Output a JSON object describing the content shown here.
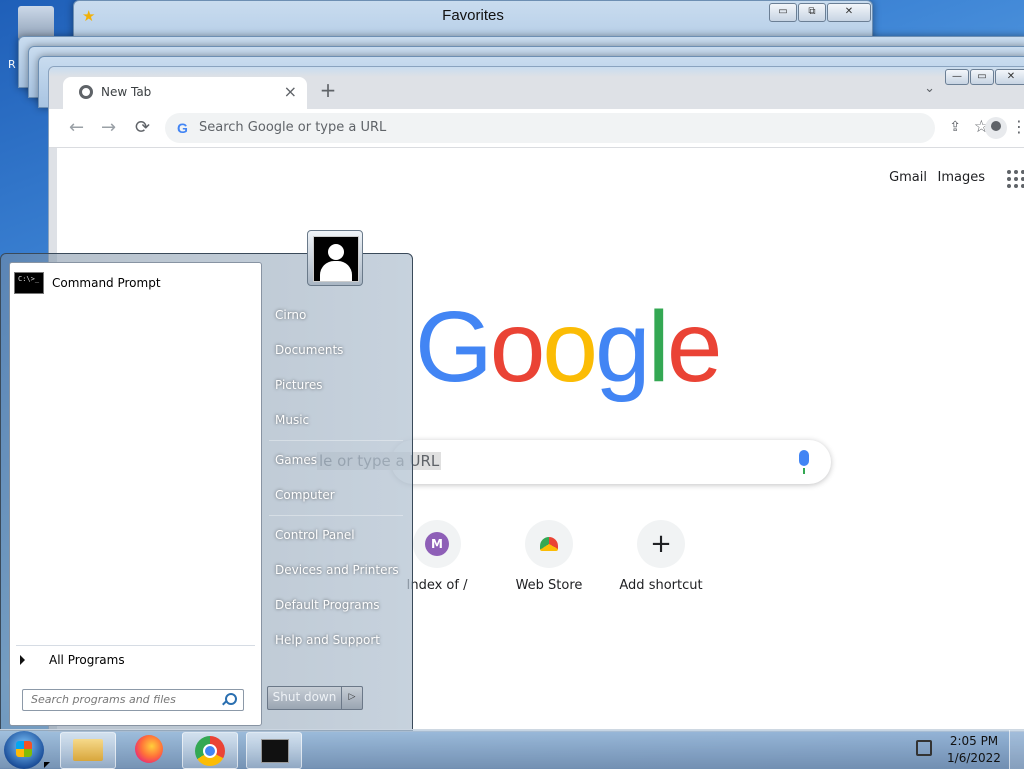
{
  "desktop": {
    "side_letter": "R"
  },
  "favorites_window": {
    "title": "Favorites",
    "minimize": "▭",
    "restore": "⧉",
    "close": "✕"
  },
  "chrome": {
    "tab_title": "New Tab",
    "tab_close": "×",
    "new_tab": "+",
    "tab_search": "⌄",
    "back": "←",
    "forward": "→",
    "reload": "⟳",
    "omnibox_placeholder": "Search Google or type a URL",
    "omnibox_g": "G",
    "share": "⇪",
    "bookmark": "☆",
    "menu": "⋮",
    "window_min": "—",
    "window_max": "▭",
    "window_close": "✕"
  },
  "ntp": {
    "gmail": "Gmail",
    "images": "Images",
    "logo_letters": [
      {
        "ch": "G",
        "color": "#4285f4"
      },
      {
        "ch": "o",
        "color": "#ea4335"
      },
      {
        "ch": "o",
        "color": "#fbbc05"
      },
      {
        "ch": "g",
        "color": "#4285f4"
      },
      {
        "ch": "l",
        "color": "#34a853"
      },
      {
        "ch": "e",
        "color": "#ea4335"
      }
    ],
    "search_placeholder": "Search Google or type a URL",
    "search_visible": "le or type a URL",
    "shortcuts": [
      {
        "label": "Index of /",
        "badge": "M"
      },
      {
        "label": "Web Store",
        "badge": ""
      },
      {
        "label": "Add shortcut",
        "badge": "+"
      }
    ]
  },
  "start_menu": {
    "pinned": [
      {
        "label": "Command Prompt",
        "icon_text": "C:\\>_"
      }
    ],
    "all_programs": "All Programs",
    "search_placeholder": "Search programs and files",
    "right_links": [
      "Cirno",
      "Documents",
      "Pictures",
      "Music",
      "Games",
      "Computer",
      "Control Panel",
      "Devices and Printers",
      "Default Programs",
      "Help and Support"
    ],
    "shutdown": "Shut down",
    "shutdown_arrow": "▷"
  },
  "taskbar": {
    "time": "2:05 PM",
    "date": "1/6/2022",
    "pinned": [
      "Windows Explorer",
      "Firefox",
      "Google Chrome",
      "Command Prompt"
    ]
  }
}
